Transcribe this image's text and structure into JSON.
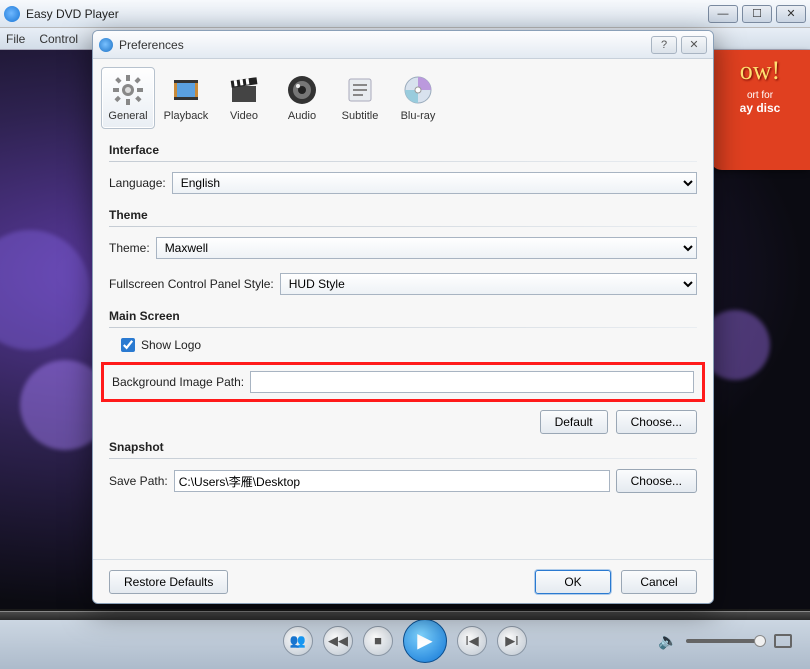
{
  "app": {
    "title": "Easy DVD Player"
  },
  "menu": {
    "file": "File",
    "control": "Control"
  },
  "ribbon": {
    "big": "ow!",
    "small1": "ort for",
    "small2": "ay disc"
  },
  "prefs": {
    "title": "Preferences",
    "tabs": {
      "general": "General",
      "playback": "Playback",
      "video": "Video",
      "audio": "Audio",
      "subtitle": "Subtitle",
      "bluray": "Blu-ray"
    },
    "interface": {
      "heading": "Interface",
      "language_label": "Language:",
      "language_value": "English"
    },
    "theme": {
      "heading": "Theme",
      "theme_label": "Theme:",
      "theme_value": "Maxwell",
      "fullscreen_label": "Fullscreen Control Panel Style:",
      "fullscreen_value": "HUD Style"
    },
    "mainscreen": {
      "heading": "Main Screen",
      "show_logo": "Show Logo",
      "bg_label": "Background Image Path:",
      "bg_value": "",
      "default_btn": "Default",
      "choose_btn": "Choose..."
    },
    "snapshot": {
      "heading": "Snapshot",
      "save_label": "Save Path:",
      "save_value": "C:\\Users\\李雁\\Desktop",
      "choose_btn": "Choose..."
    },
    "footer": {
      "restore": "Restore Defaults",
      "ok": "OK",
      "cancel": "Cancel"
    }
  }
}
